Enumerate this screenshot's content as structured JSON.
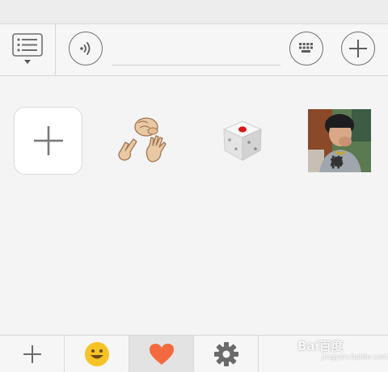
{
  "toolbar": {
    "menu_icon": "list-menu-icon",
    "voice_icon": "voice-wave-icon",
    "input_placeholder": "",
    "keyboard_icon": "keyboard-icon",
    "more_icon": "plus-icon"
  },
  "stickers": [
    {
      "name": "add-sticker",
      "icon": "plus-icon"
    },
    {
      "name": "rock-paper-scissors",
      "icon": "hand-game-icon"
    },
    {
      "name": "dice",
      "icon": "dice-icon"
    },
    {
      "name": "photo-sticker",
      "caption": "棒"
    }
  ],
  "tabs": [
    {
      "icon": "plus-icon",
      "active": false
    },
    {
      "icon": "smiley-icon",
      "active": false
    },
    {
      "icon": "heart-icon",
      "active": true
    },
    {
      "icon": "gear-icon",
      "active": false
    }
  ],
  "watermark": {
    "text": "Bai百度",
    "sub": "jingyan.baidu.com"
  },
  "colors": {
    "heart": "#f26a3d",
    "smiley": "#f6c325",
    "dice_dot": "#d8151b",
    "icon_gray": "#6f6f6f"
  }
}
